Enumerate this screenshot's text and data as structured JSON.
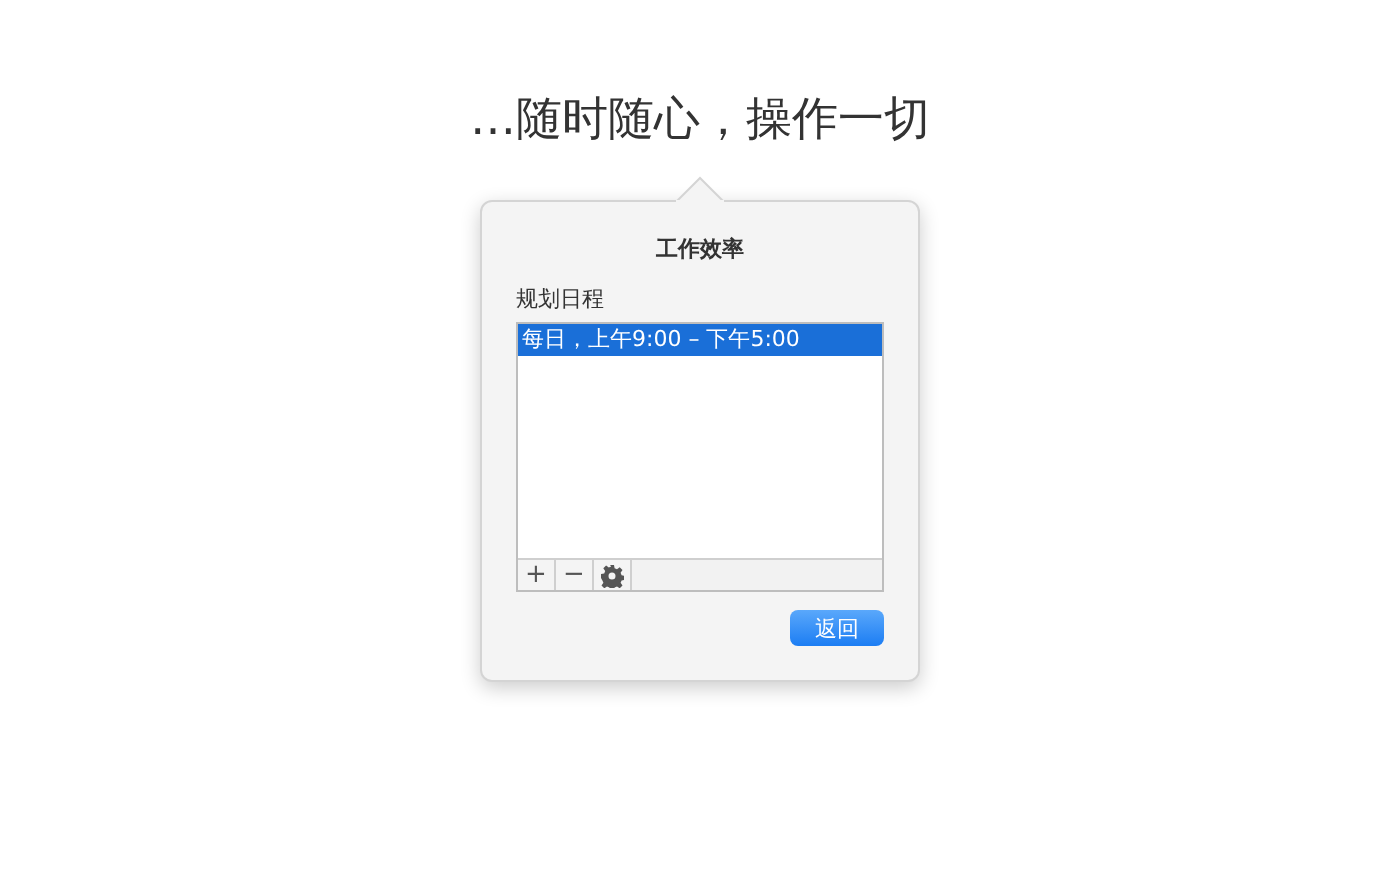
{
  "headline": "…随时随心，操作一切",
  "popover": {
    "title": "工作效率",
    "section_label": "规划日程",
    "list": [
      {
        "label": "每日，上午9:00 – 下午5:00",
        "selected": true
      }
    ],
    "toolbar": [
      {
        "kind": "text",
        "label": "+"
      },
      {
        "kind": "text",
        "label": "−"
      },
      {
        "kind": "gear"
      }
    ],
    "button": "返回"
  }
}
